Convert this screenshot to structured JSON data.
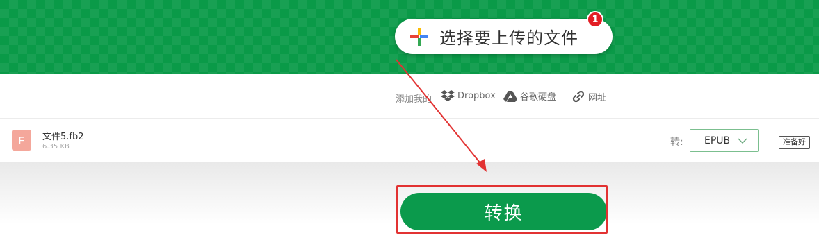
{
  "header": {
    "choose_label": "选择要上传的文件",
    "badge_count": "1"
  },
  "add_from": {
    "label": "添加我的",
    "sources": [
      {
        "icon": "dropbox-icon",
        "label": "Dropbox"
      },
      {
        "icon": "google-drive-icon",
        "label": "谷歌硬盘"
      },
      {
        "icon": "link-icon",
        "label": "网址"
      }
    ]
  },
  "file": {
    "icon_letter": "F",
    "name": "文件5.fb2",
    "size": "6.35 KB",
    "to_label": "转:",
    "format": "EPUB",
    "status": "准备好"
  },
  "actions": {
    "convert_label": "转换"
  },
  "colors": {
    "brand_green": "#0a9a48",
    "annotation_red": "#e23232",
    "badge_red": "#e21d24"
  }
}
